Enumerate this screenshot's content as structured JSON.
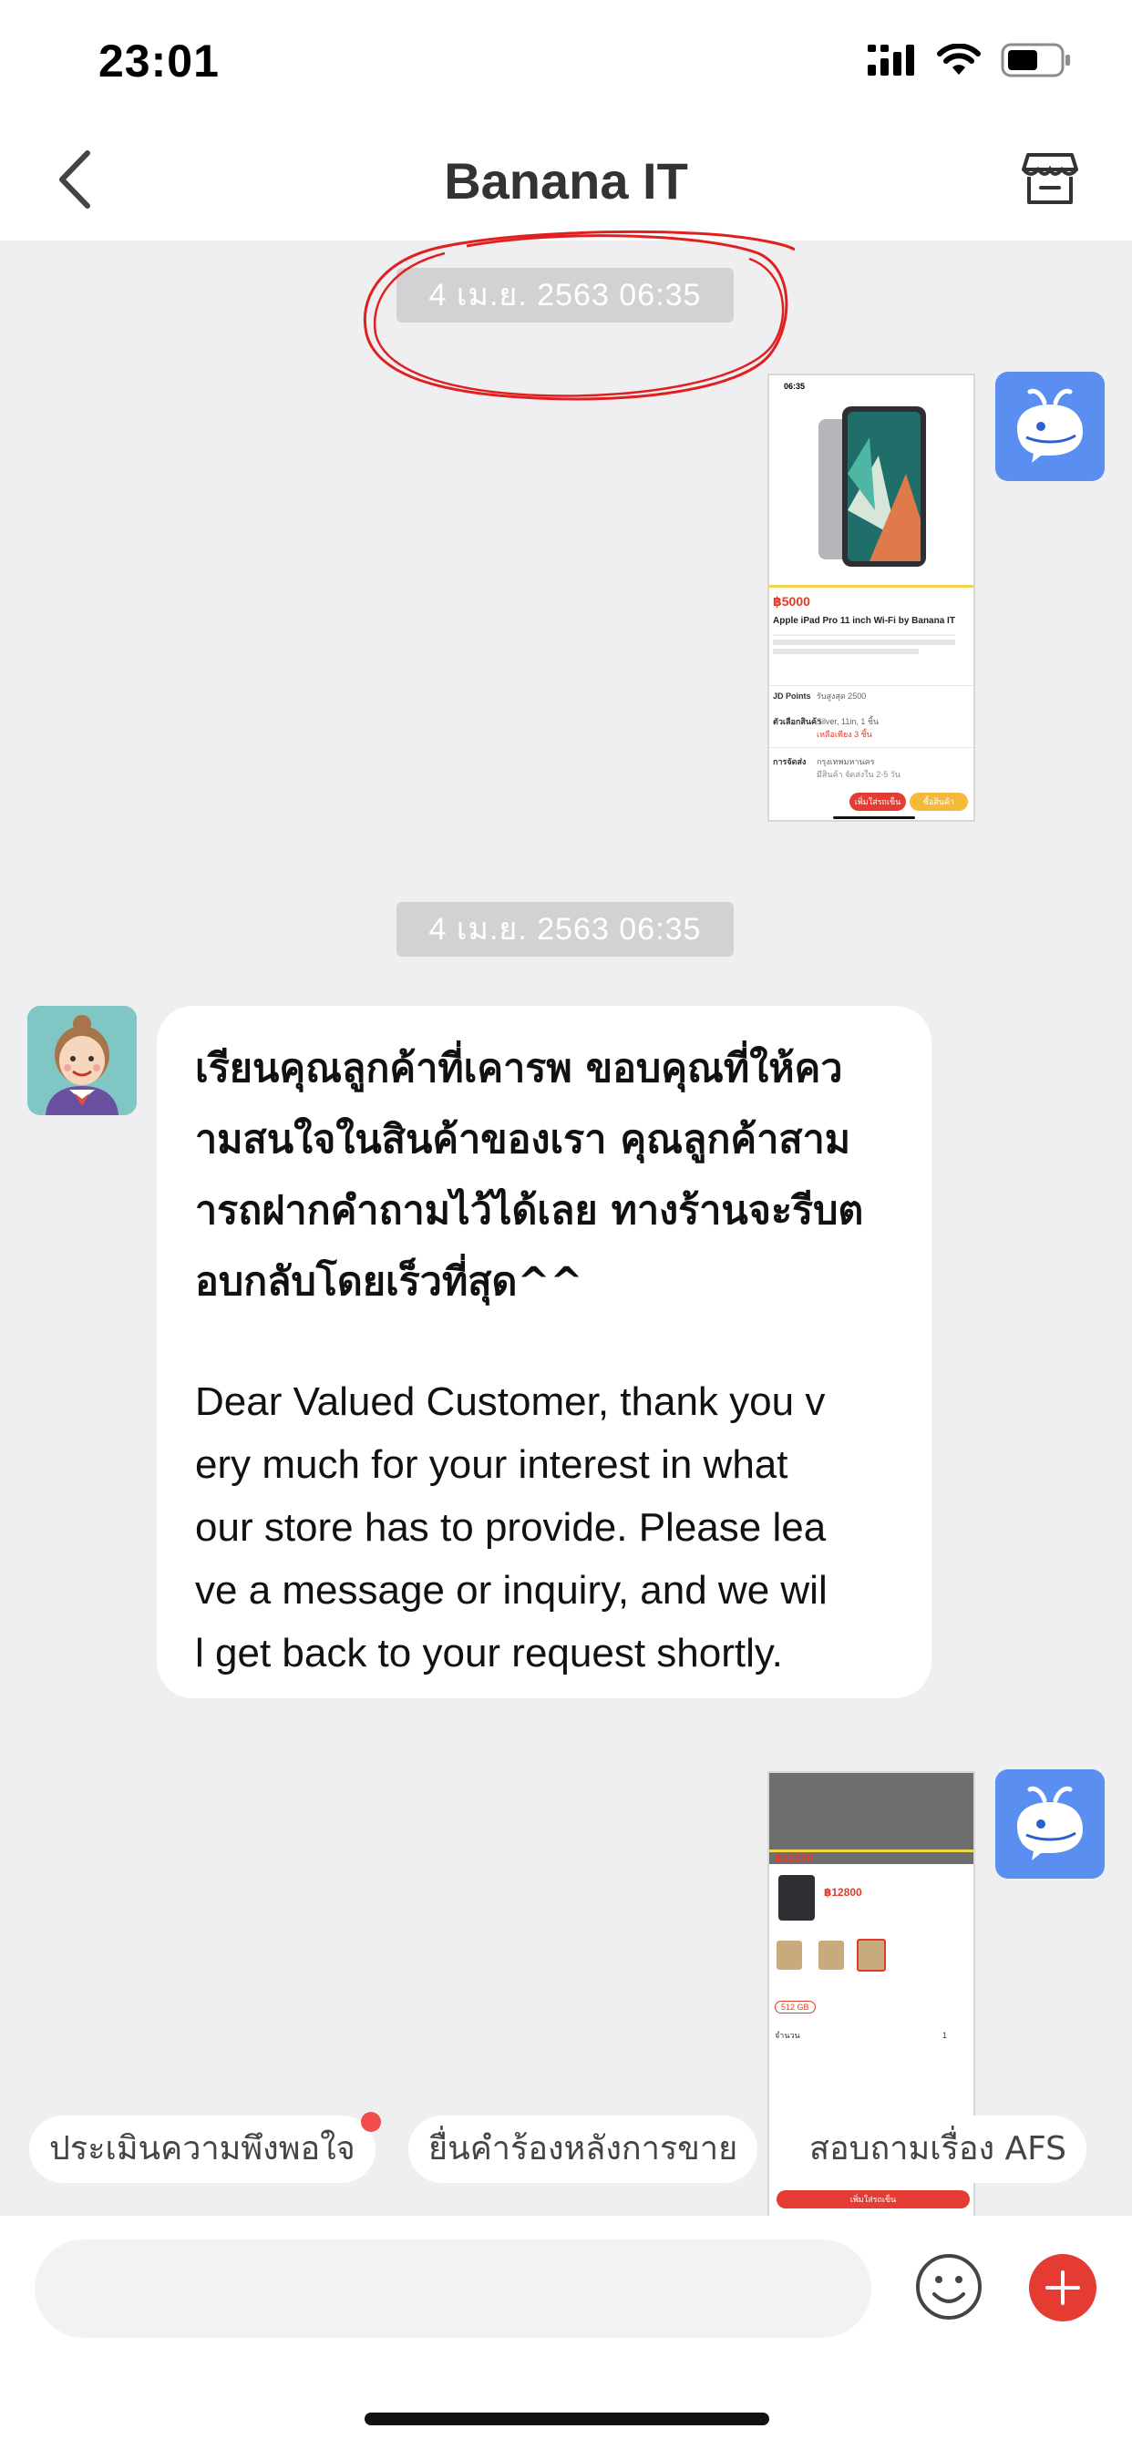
{
  "status_bar": {
    "time": "23:01",
    "icons": [
      "signal-icon",
      "wifi-icon",
      "battery-icon"
    ]
  },
  "nav": {
    "title": "Banana IT",
    "back_icon": "chevron-left-icon",
    "store_icon": "store-icon"
  },
  "messages": [
    {
      "type": "timestamp",
      "text": "4 เม.ย. 2563 06:35"
    },
    {
      "type": "image",
      "sender": "me",
      "avatar_icon": "whale-icon",
      "preview": {
        "status_time": "06:35",
        "price": "฿5000",
        "title": "Apple iPad Pro 11 inch Wi-Fi by Banana IT",
        "points_label": "JD Points",
        "points_value": "รับสูงสุด 2500",
        "variant_label": "ตัวเลือกสินค้า",
        "variant_value": "Silver, 11in, 1 ชิ้น",
        "stock": "เหลือเพียง 3 ชิ้น",
        "ship_label": "การจัดส่ง",
        "ship_value": "กรุงเทพมหานคร",
        "ship_eta": "มีสินค้า จัดส่งใน 2-5 วัน",
        "btn_cart": "เพิ่มใส่รถเข็น",
        "btn_buy": "ซื้อสินค้า"
      }
    },
    {
      "type": "timestamp",
      "text": "4 เม.ย. 2563 06:35"
    },
    {
      "type": "text",
      "sender": "shop",
      "avatar_icon": "agent-avatar",
      "thai": "เรียนคุณลูกค้าที่เคารพ ขอบคุณที่ให้คว\nามสนใจในสินค้าของเรา คุณลูกค้าสาม\nารถฝากคำถามไว้ได้เลย ทางร้านจะรีบต\nอบกลับโดยเร็วที่สุด^^",
      "english": "Dear Valued Customer, thank you v\nery much for your interest in what\nour store has to provide. Please lea\nve a message or inquiry, and we wil\nl get back to your request shortly."
    },
    {
      "type": "image",
      "sender": "me",
      "avatar_icon": "whale-icon",
      "preview": {
        "price_top": "฿12800",
        "price": "฿12800",
        "storage": "512 GB",
        "qty_label": "จำนวน",
        "qty_value": "1",
        "btn_cart": "เพิ่มใส่รถเข็น"
      }
    }
  ],
  "quick_replies": [
    {
      "label": "ประเมินความพึงพอใจ",
      "badge": true
    },
    {
      "label": "ยื่นคำร้องหลังการขาย",
      "badge": false
    },
    {
      "label": "สอบถามเรื่อง AFS",
      "badge": false
    }
  ],
  "composer": {
    "placeholder": "",
    "value": "",
    "emoji_icon": "emoji-icon",
    "plus_icon": "plus-icon"
  },
  "colors": {
    "accent_red": "#e43c32",
    "bot_avatar_blue": "#5a8ef0",
    "annotation_red": "#e02020",
    "background": "#efeff1",
    "timestamp_bg": "#d2d2d4"
  }
}
